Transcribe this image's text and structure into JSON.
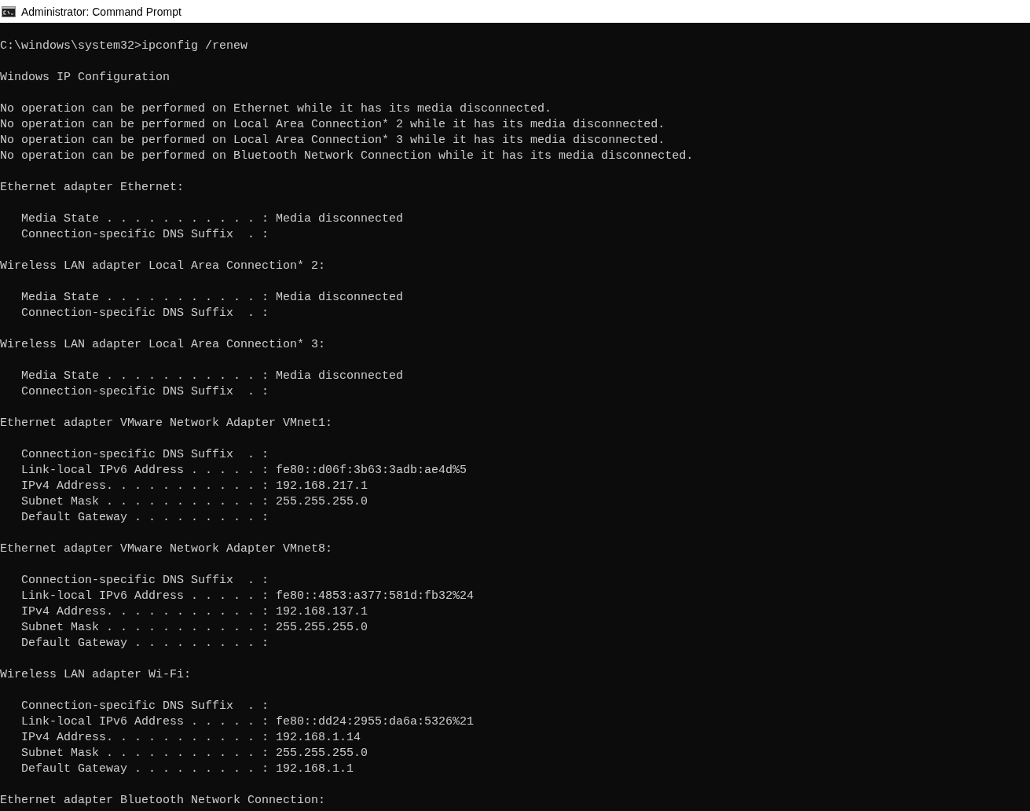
{
  "window": {
    "title": "Administrator: Command Prompt"
  },
  "console": {
    "blocks": [
      [
        "C:\\windows\\system32>ipconfig /renew"
      ],
      [
        "Windows IP Configuration"
      ],
      [
        "No operation can be performed on Ethernet while it has its media disconnected.",
        "No operation can be performed on Local Area Connection* 2 while it has its media disconnected.",
        "No operation can be performed on Local Area Connection* 3 while it has its media disconnected.",
        "No operation can be performed on Bluetooth Network Connection while it has its media disconnected."
      ],
      [
        "Ethernet adapter Ethernet:"
      ],
      [
        "   Media State . . . . . . . . . . . : Media disconnected",
        "   Connection-specific DNS Suffix  . :"
      ],
      [
        "Wireless LAN adapter Local Area Connection* 2:"
      ],
      [
        "   Media State . . . . . . . . . . . : Media disconnected",
        "   Connection-specific DNS Suffix  . :"
      ],
      [
        "Wireless LAN adapter Local Area Connection* 3:"
      ],
      [
        "   Media State . . . . . . . . . . . : Media disconnected",
        "   Connection-specific DNS Suffix  . :"
      ],
      [
        "Ethernet adapter VMware Network Adapter VMnet1:"
      ],
      [
        "   Connection-specific DNS Suffix  . :",
        "   Link-local IPv6 Address . . . . . : fe80::d06f:3b63:3adb:ae4d%5",
        "   IPv4 Address. . . . . . . . . . . : 192.168.217.1",
        "   Subnet Mask . . . . . . . . . . . : 255.255.255.0",
        "   Default Gateway . . . . . . . . . :"
      ],
      [
        "Ethernet adapter VMware Network Adapter VMnet8:"
      ],
      [
        "   Connection-specific DNS Suffix  . :",
        "   Link-local IPv6 Address . . . . . : fe80::4853:a377:581d:fb32%24",
        "   IPv4 Address. . . . . . . . . . . : 192.168.137.1",
        "   Subnet Mask . . . . . . . . . . . : 255.255.255.0",
        "   Default Gateway . . . . . . . . . :"
      ],
      [
        "Wireless LAN adapter Wi-Fi:"
      ],
      [
        "   Connection-specific DNS Suffix  . :",
        "   Link-local IPv6 Address . . . . . : fe80::dd24:2955:da6a:5326%21",
        "   IPv4 Address. . . . . . . . . . . : 192.168.1.14",
        "   Subnet Mask . . . . . . . . . . . : 255.255.255.0",
        "   Default Gateway . . . . . . . . . : 192.168.1.1"
      ],
      [
        "Ethernet adapter Bluetooth Network Connection:"
      ]
    ]
  }
}
